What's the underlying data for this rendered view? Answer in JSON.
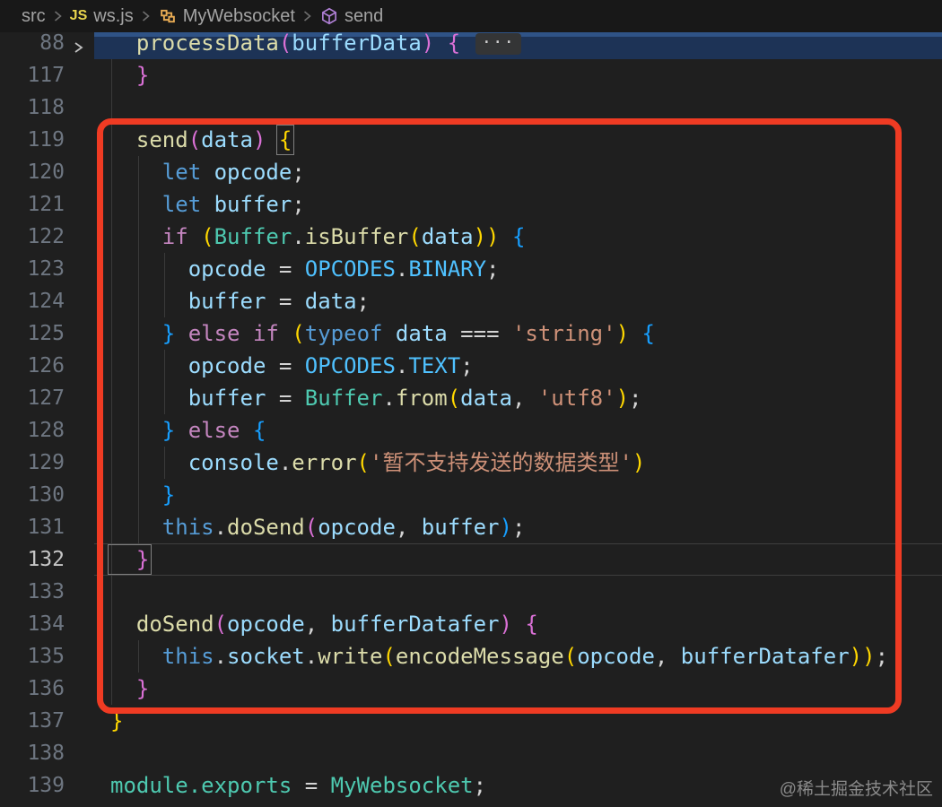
{
  "breadcrumb": {
    "items": [
      {
        "label": "src"
      },
      {
        "label": "ws.js",
        "icon": "js-file-icon",
        "icon_text": "JS"
      },
      {
        "label": "MyWebsocket",
        "icon": "class-icon"
      },
      {
        "label": "send",
        "icon": "method-icon"
      }
    ]
  },
  "colors": {
    "editor_bg": "#1f1f1f",
    "breadcrumb_bg": "#181818",
    "js_icon": "#e8d44d",
    "class_icon": "#E8AB53",
    "method_icon": "#B180D7",
    "line_number": "#6e7681",
    "line_number_active": "#c6c6c6",
    "highlight_row": "#1d3356",
    "highlight_row_top": "#2f5386",
    "annotation": "#ef3b23",
    "guide": "#3a3a3a",
    "watermark": "#8a8a8a",
    "badge_bg": "#343536",
    "box_border": "#808080",
    "current_border": "#3e3e3e",
    "kb": "#569CD6",
    "kp": "#C586C0",
    "v": "#9CDCFE",
    "c": "#4FC1FF",
    "f": "#DCDCAA",
    "t": "#4EC9B0",
    "s": "#CE9178",
    "o": "#D4D4D4",
    "bg": "#FFD700",
    "bp": "#DA70D6",
    "bb": "#179FFF"
  },
  "editor": {
    "fold_badge": "···",
    "lines": [
      {
        "num": "88",
        "fold": true,
        "highlight": true,
        "badge": true,
        "guides": [],
        "tokens": [
          [
            "  processData",
            "f"
          ],
          [
            "(",
            "bp"
          ],
          [
            "bufferData",
            "v"
          ],
          [
            ") ",
            "bp"
          ],
          [
            "{ ",
            "bp"
          ]
        ]
      },
      {
        "num": "117",
        "guides": [
          124
        ],
        "tokens": [
          [
            "  }",
            "bp"
          ]
        ]
      },
      {
        "num": "118",
        "guides": [
          124
        ],
        "tokens": []
      },
      {
        "num": "119",
        "guides": [
          124
        ],
        "tokens": [
          [
            "  send",
            "f"
          ],
          [
            "(",
            "bp"
          ],
          [
            "data",
            "v"
          ],
          [
            ") ",
            "bp"
          ],
          [
            "{",
            "bg",
            "box"
          ]
        ]
      },
      {
        "num": "120",
        "guides": [
          124,
          154
        ],
        "tokens": [
          [
            "    let",
            "kb"
          ],
          [
            " opcode",
            "v"
          ],
          [
            ";",
            "o"
          ]
        ]
      },
      {
        "num": "121",
        "guides": [
          124,
          154
        ],
        "tokens": [
          [
            "    let",
            "kb"
          ],
          [
            " buffer",
            "v"
          ],
          [
            ";",
            "o"
          ]
        ]
      },
      {
        "num": "122",
        "guides": [
          124,
          154
        ],
        "tokens": [
          [
            "    if",
            "kp"
          ],
          [
            " (",
            "bg"
          ],
          [
            "Buffer",
            "t"
          ],
          [
            ".",
            "o"
          ],
          [
            "isBuffer",
            "f"
          ],
          [
            "(",
            "bg"
          ],
          [
            "data",
            "v"
          ],
          [
            "))",
            "bg"
          ],
          [
            " {",
            "bb"
          ]
        ]
      },
      {
        "num": "123",
        "guides": [
          124,
          154,
          183
        ],
        "tokens": [
          [
            "      opcode",
            "v"
          ],
          [
            " =",
            "o"
          ],
          [
            " OPCODES",
            "c"
          ],
          [
            ".",
            "o"
          ],
          [
            "BINARY",
            "c"
          ],
          [
            ";",
            "o"
          ]
        ]
      },
      {
        "num": "124",
        "guides": [
          124,
          154,
          183
        ],
        "tokens": [
          [
            "      buffer",
            "v"
          ],
          [
            " =",
            "o"
          ],
          [
            " data",
            "v"
          ],
          [
            ";",
            "o"
          ]
        ]
      },
      {
        "num": "125",
        "guides": [
          124,
          154
        ],
        "tokens": [
          [
            "    }",
            "bb"
          ],
          [
            " else",
            "kp"
          ],
          [
            " if",
            "kp"
          ],
          [
            " (",
            "bg"
          ],
          [
            "typeof",
            "kb"
          ],
          [
            " data",
            "v"
          ],
          [
            " ===",
            "o"
          ],
          [
            " 'string'",
            "s"
          ],
          [
            ")",
            "bg"
          ],
          [
            " {",
            "bb"
          ]
        ]
      },
      {
        "num": "126",
        "guides": [
          124,
          154,
          183
        ],
        "tokens": [
          [
            "      opcode",
            "v"
          ],
          [
            " =",
            "o"
          ],
          [
            " OPCODES",
            "c"
          ],
          [
            ".",
            "o"
          ],
          [
            "TEXT",
            "c"
          ],
          [
            ";",
            "o"
          ]
        ]
      },
      {
        "num": "127",
        "guides": [
          124,
          154,
          183
        ],
        "tokens": [
          [
            "      buffer",
            "v"
          ],
          [
            " =",
            "o"
          ],
          [
            " Buffer",
            "t"
          ],
          [
            ".",
            "o"
          ],
          [
            "from",
            "f"
          ],
          [
            "(",
            "bg"
          ],
          [
            "data",
            "v"
          ],
          [
            ",",
            "o"
          ],
          [
            " 'utf8'",
            "s"
          ],
          [
            ")",
            "bg"
          ],
          [
            ";",
            "o"
          ]
        ]
      },
      {
        "num": "128",
        "guides": [
          124,
          154
        ],
        "tokens": [
          [
            "    }",
            "bb"
          ],
          [
            " else",
            "kp"
          ],
          [
            " {",
            "bb"
          ]
        ]
      },
      {
        "num": "129",
        "guides": [
          124,
          154,
          183
        ],
        "tokens": [
          [
            "      console",
            "v"
          ],
          [
            ".",
            "o"
          ],
          [
            "error",
            "f"
          ],
          [
            "(",
            "bg"
          ],
          [
            "'暂不支持发送的数据类型'",
            "s"
          ],
          [
            ")",
            "bg"
          ]
        ]
      },
      {
        "num": "130",
        "guides": [
          124,
          154
        ],
        "tokens": [
          [
            "    }",
            "bb"
          ]
        ]
      },
      {
        "num": "131",
        "guides": [
          124,
          154
        ],
        "tokens": [
          [
            "    this",
            "kb"
          ],
          [
            ".",
            "o"
          ],
          [
            "doSend",
            "f"
          ],
          [
            "(",
            "bp"
          ],
          [
            "opcode",
            "v"
          ],
          [
            ",",
            "o"
          ],
          [
            " buffer",
            "v"
          ],
          [
            ")",
            "bb"
          ],
          [
            ";",
            "o"
          ]
        ]
      },
      {
        "num": "132",
        "current": true,
        "guides": [
          124
        ],
        "tokens": [
          [
            "  }",
            "bp",
            "box"
          ]
        ]
      },
      {
        "num": "133",
        "guides": [
          124
        ],
        "tokens": []
      },
      {
        "num": "134",
        "guides": [
          124
        ],
        "tokens": [
          [
            "  doSend",
            "f"
          ],
          [
            "(",
            "bp"
          ],
          [
            "opcode",
            "v"
          ],
          [
            ",",
            "o"
          ],
          [
            " bufferDatafer",
            "v"
          ],
          [
            ") ",
            "bp"
          ],
          [
            "{",
            "bp"
          ]
        ]
      },
      {
        "num": "135",
        "guides": [
          124,
          154
        ],
        "tokens": [
          [
            "    this",
            "kb"
          ],
          [
            ".",
            "o"
          ],
          [
            "socket",
            "v"
          ],
          [
            ".",
            "o"
          ],
          [
            "write",
            "f"
          ],
          [
            "(",
            "bg"
          ],
          [
            "encodeMessage",
            "f"
          ],
          [
            "(",
            "bg"
          ],
          [
            "opcode",
            "v"
          ],
          [
            ",",
            "o"
          ],
          [
            " bufferDatafer",
            "v"
          ],
          [
            "))",
            "bg"
          ],
          [
            ";",
            "o"
          ]
        ]
      },
      {
        "num": "136",
        "guides": [
          124
        ],
        "tokens": [
          [
            "  }",
            "bp"
          ]
        ]
      },
      {
        "num": "137",
        "guides": [],
        "tokens": [
          [
            "}",
            "bg"
          ]
        ]
      },
      {
        "num": "138",
        "guides": [],
        "tokens": []
      },
      {
        "num": "139",
        "guides": [],
        "tokens": [
          [
            "module.exports",
            "t"
          ],
          [
            " = ",
            "o"
          ],
          [
            "MyWebsocket",
            "t"
          ],
          [
            ";",
            "o"
          ]
        ]
      }
    ]
  },
  "watermark": {
    "text": "@稀土掘金技术社区"
  }
}
